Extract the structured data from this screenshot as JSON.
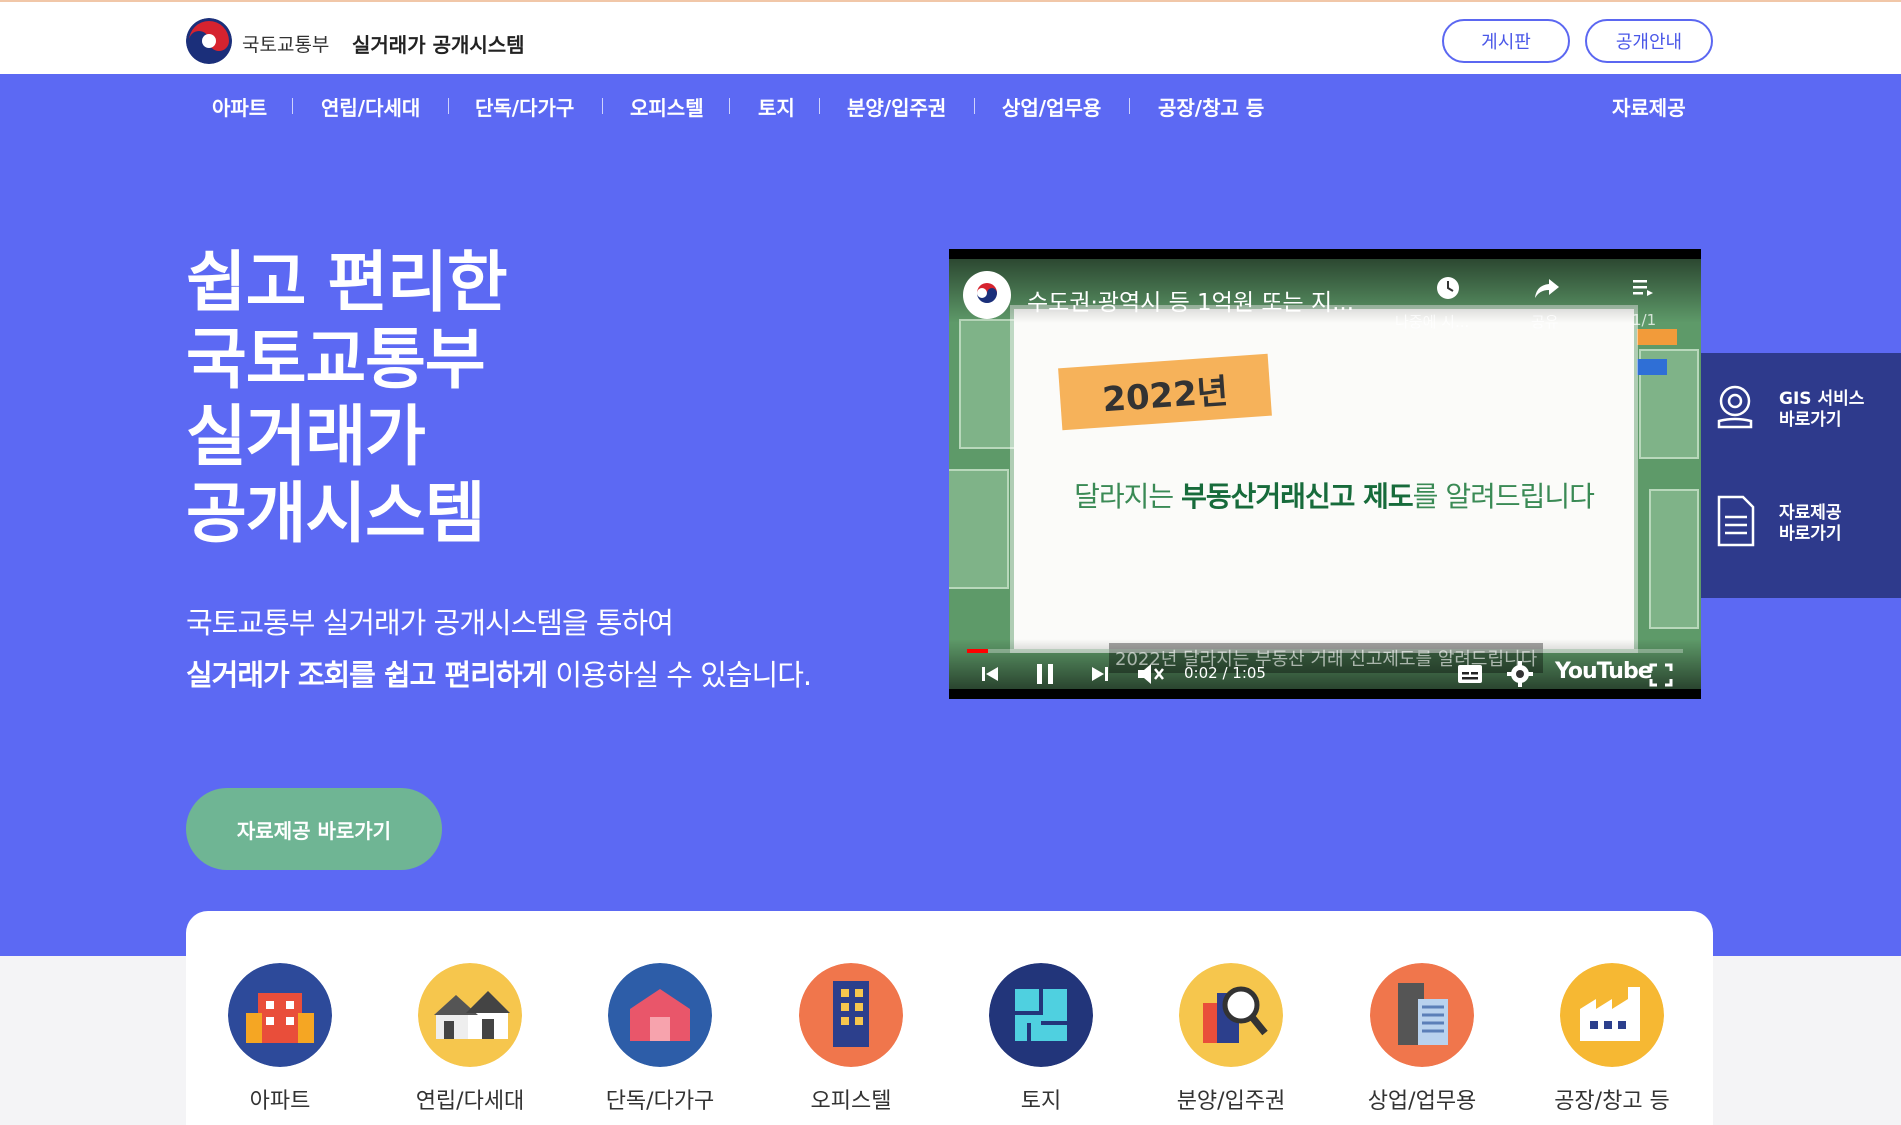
{
  "header": {
    "ministry": "국토교통부",
    "system": "실거래가 공개시스템",
    "buttons": {
      "board": "게시판",
      "info": "공개안내"
    }
  },
  "nav": {
    "items": [
      "아파트",
      "연립/다세대",
      "단독/다가구",
      "오피스텔",
      "토지",
      "분양/입주권",
      "상업/업무용",
      "공장/창고 등"
    ],
    "data": "자료제공"
  },
  "hero": {
    "title_lines": [
      "쉽고 편리한",
      "국토교통부",
      "실거래가",
      "공개시스템"
    ],
    "sub1": "국토교통부 실거래가 공개시스템을 통하여",
    "sub2_bold": "실거래가 조회를 쉽고 편리하게",
    "sub2_rest": " 이용하실 수 있습니다.",
    "cta": "자료제공 바로가기"
  },
  "video": {
    "title": "수도권·광역시 등 1억원 또는 지...",
    "watch_later": "나중에 시...",
    "share": "공유",
    "playlist": "1/1",
    "year": "2022년",
    "slide_pre": "달라지는 ",
    "slide_bold": "부동산거래신고 제도",
    "slide_post": "를 알려드립니다",
    "subtitle": "2022년 달라지는 부동산 거래 신고제도를 알려드립니다",
    "time": "0:02 / 1:05",
    "brand": "YouTube",
    "progress": 0.03
  },
  "side": {
    "gis_line1": "GIS 서비스",
    "gis_line2": "바로가기",
    "data_line1": "자료제공",
    "data_line2": "바로가기"
  },
  "categories": [
    {
      "label": "아파트",
      "color": "#2d4a9a"
    },
    {
      "label": "연립/다세대",
      "color": "#f6c64d"
    },
    {
      "label": "단독/다가구",
      "color": "#2d5da8"
    },
    {
      "label": "오피스텔",
      "color": "#f0764c"
    },
    {
      "label": "토지",
      "color": "#22357a"
    },
    {
      "label": "분양/입주권",
      "color": "#f6c64d"
    },
    {
      "label": "상업/업무용",
      "color": "#f0764c"
    },
    {
      "label": "공장/창고 등",
      "color": "#f6b833"
    }
  ]
}
